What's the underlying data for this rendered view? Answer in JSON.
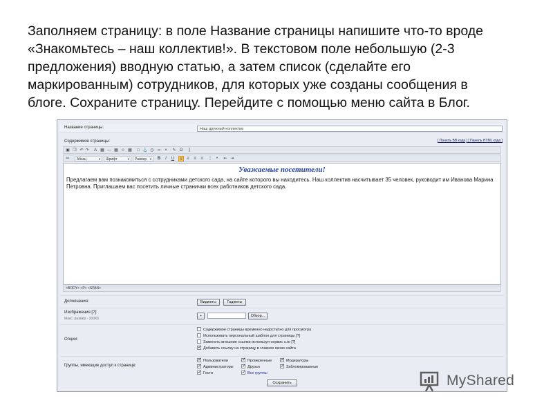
{
  "intro": {
    "lines": [
      "Заполняем страницу: в поле Название страницы напишите что-то вроде",
      "«Знакомьтесь – наш коллектив!». В текстовом поле небольшую (2-3",
      "предложения) вводную статью, а затем список (сделайте его",
      "маркированным) сотрудников, для которых уже созданы сообщения в",
      "блоге. Сохраните страницу. Перейдите с помощью меню сайта в Блог."
    ]
  },
  "form": {
    "page_name_label": "Название страницы:",
    "page_name_value": "Наш дружный коллектив",
    "content_label": "Содержимое страницы:",
    "panel_links": {
      "bb": "[ Панель BB кода",
      "html": "] [ Панель HTML кода ]"
    },
    "toolbar2": {
      "paragraph": "Абзац",
      "font": "Шрифт",
      "size": "Размер",
      "bold": "B",
      "italic": "I",
      "underline": "U"
    },
    "editor": {
      "heading": "Уважаемые посетители!",
      "text": "Предлагаем вам познакомиться с сотрудниками детского сада, на сайте которого вы находитесь. Наш коллектив насчитывает 35 человек, руководит им Иванова Марина Петровна. Приглашаем вас посетить личные странички всех работников детского сада."
    },
    "path": "<BODY> <P> <SPAN>",
    "additions_label": "Дополнения:",
    "widgets_button": "Виджеты",
    "gadgets_button": "Гаджеты",
    "images_label": "Изображения [?]:",
    "images_hint": "Макс. размер - 200Кб",
    "plus_button": "+",
    "browse_button": "Обзор...",
    "options_label": "Опции:",
    "options": [
      {
        "label": "Содержимое страницы временно недоступно для просмотра",
        "checked": false
      },
      {
        "label": "Использовать персональный шаблон для страницы [?]",
        "checked": false
      },
      {
        "label": "Заменить внешние ссылки используя сервис u.to [?]",
        "checked": false
      },
      {
        "label": "Добавить ссылку на страницу в главное меню сайта",
        "checked": true
      }
    ],
    "groups_label": "Группы, имеющие доступ к странице:",
    "groups": [
      {
        "label": "Пользователи",
        "checked": true
      },
      {
        "label": "Проверенные",
        "checked": true
      },
      {
        "label": "Модераторы",
        "checked": true
      },
      {
        "label": "Администраторы",
        "checked": true
      },
      {
        "label": "Друзья",
        "checked": true
      },
      {
        "label": "Заблокированные",
        "checked": true
      },
      {
        "label": "Гости",
        "checked": true
      },
      {
        "label": "Все группы",
        "checked": true
      }
    ],
    "save_button": "Сохранить"
  },
  "watermark": {
    "text": "MyShared"
  },
  "colors": {
    "accent": "#1f3fa8",
    "toolbar_active": "#f6c45b",
    "form_background": "#e9edf3"
  }
}
